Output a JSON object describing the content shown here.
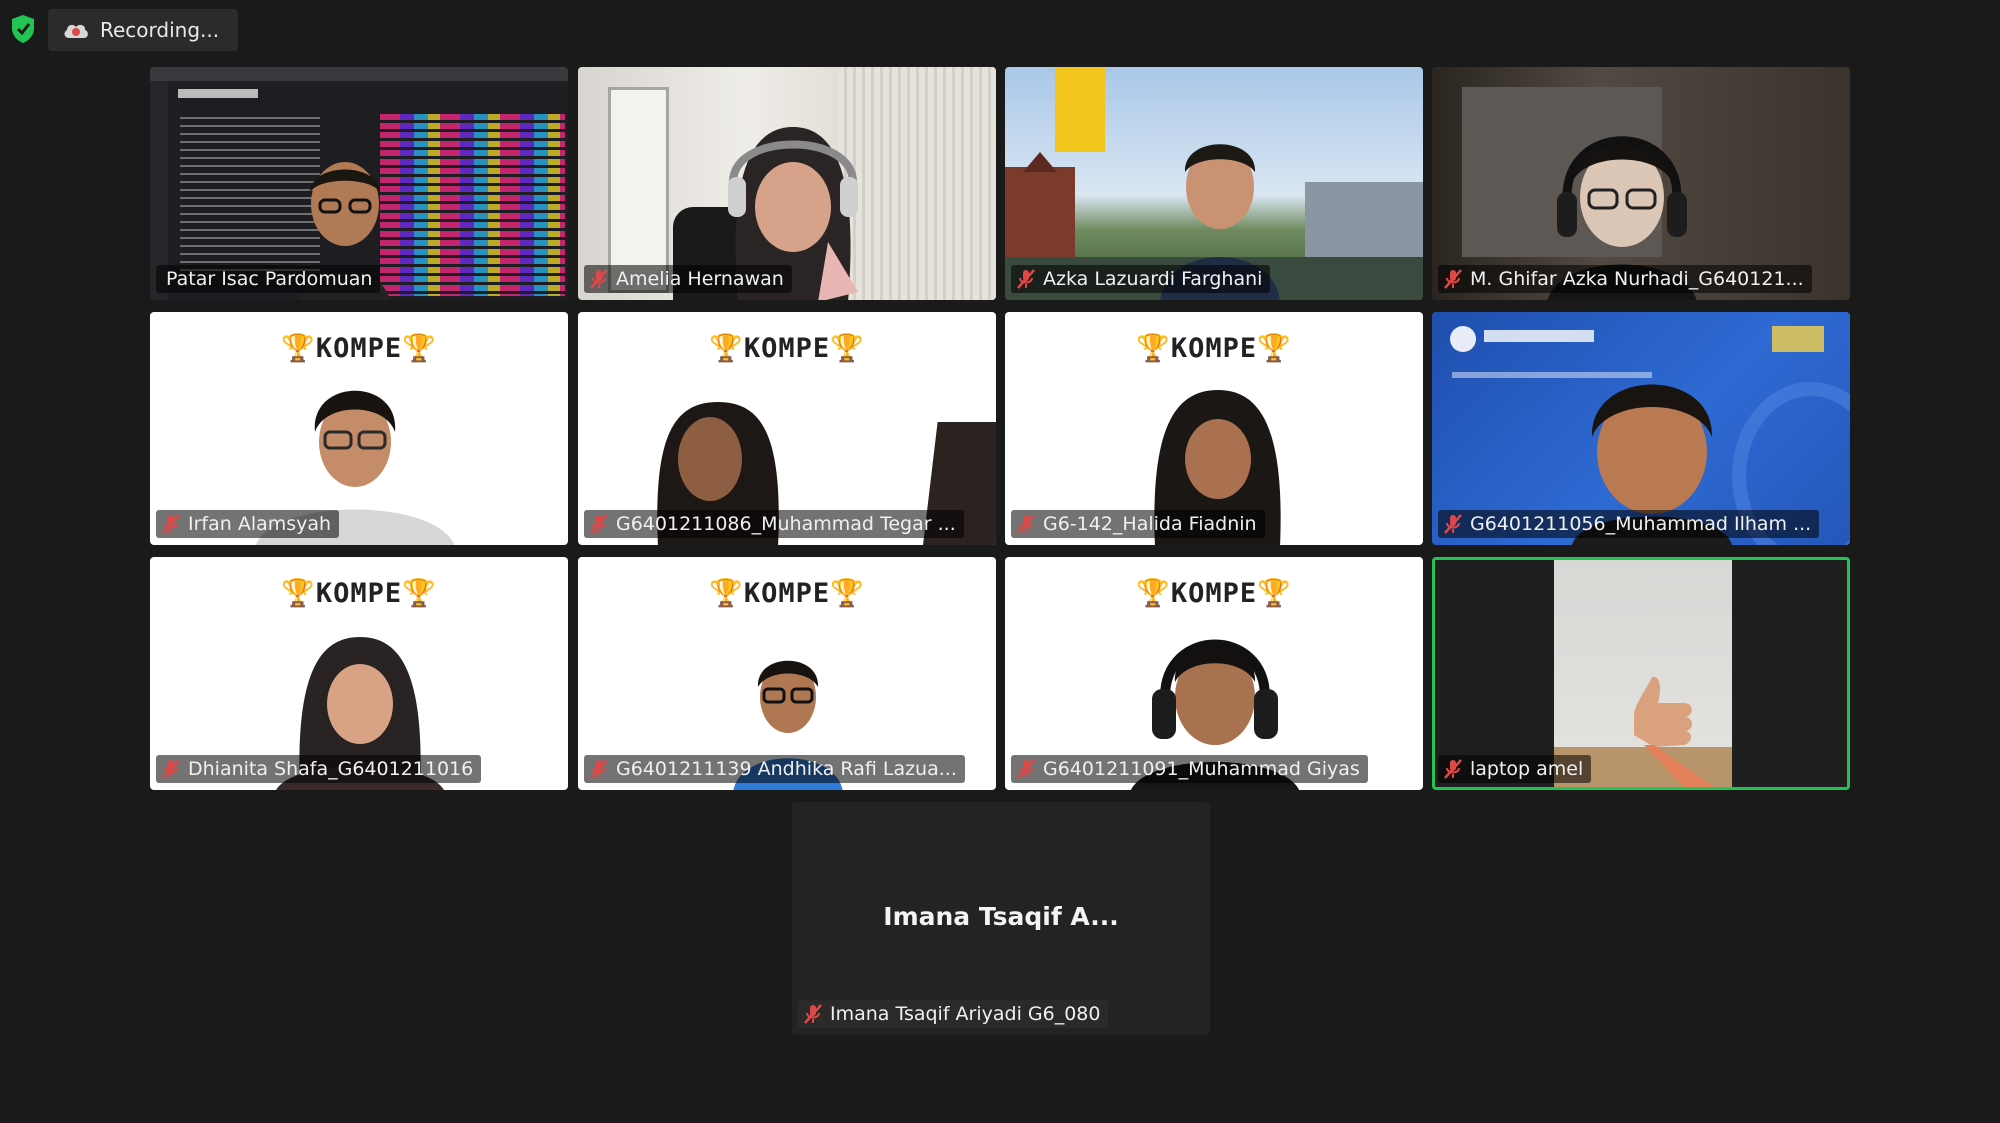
{
  "header": {
    "recording_label": "Recording..."
  },
  "overlay": {
    "kompe_text": "KOMPE",
    "trophy_glyph": "🏆"
  },
  "participants": [
    {
      "name": "Patar Isac Pardomuan",
      "muted": false
    },
    {
      "name": "Amelia Hernawan",
      "muted": true
    },
    {
      "name": "Azka Lazuardi Farghani",
      "muted": true
    },
    {
      "name": "M. Ghifar Azka Nurhadi_G640121...",
      "muted": true
    },
    {
      "name": "Irfan Alamsyah",
      "muted": true
    },
    {
      "name": "G6401211086_Muhammad Tegar ...",
      "muted": true
    },
    {
      "name": "G6-142_Halida Fiadnin",
      "muted": true
    },
    {
      "name": "G6401211056_Muhammad Ilham ...",
      "muted": true
    },
    {
      "name": "Dhianita Shafa_G6401211016",
      "muted": true
    },
    {
      "name": "G6401211139 Andhika Rafi Lazua...",
      "muted": true
    },
    {
      "name": "G6401211091_Muhammad Giyas",
      "muted": true
    },
    {
      "name": "laptop amel",
      "muted": true,
      "active_speaker": true
    }
  ],
  "no_video_participant": {
    "display_title": "Imana Tsaqif A...",
    "name": "Imana Tsaqif Ariyadi G6_080",
    "muted": true
  },
  "colors": {
    "background": "#1a1a1a",
    "active_speaker_border": "#23c552",
    "mute_icon": "#e04848"
  }
}
